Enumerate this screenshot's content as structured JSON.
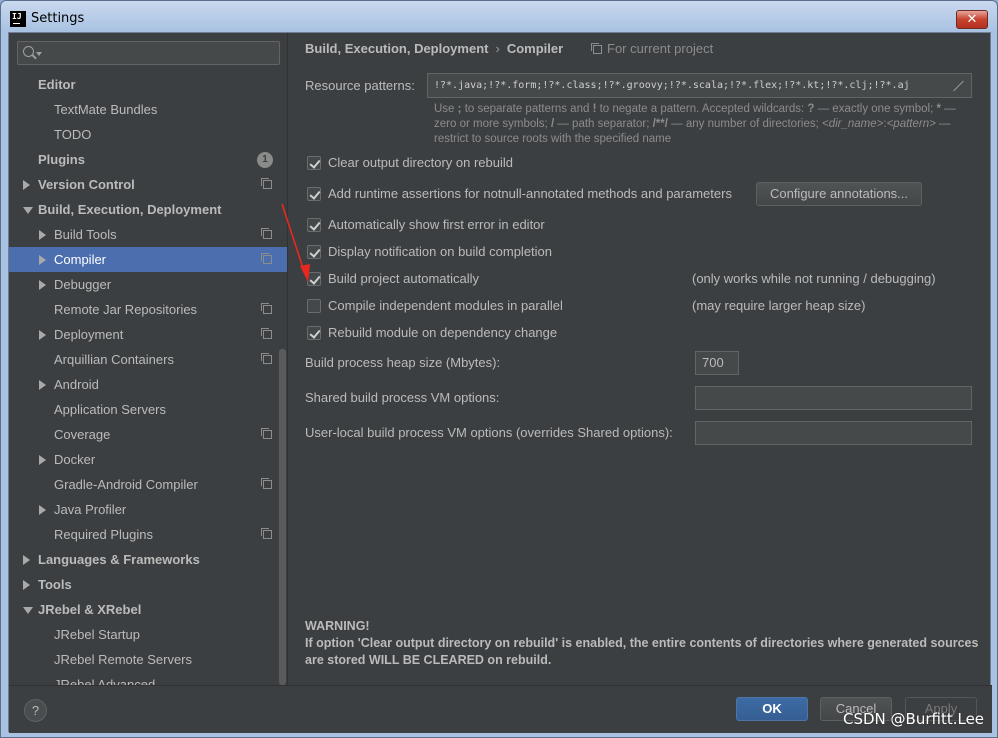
{
  "window": {
    "title": "Settings",
    "app_icon_text": "IJ",
    "close_label": "✕"
  },
  "sidebar": {
    "search_placeholder": "",
    "items": [
      {
        "label": "Editor",
        "level": 0,
        "bold": true,
        "arrow": "none",
        "project": false
      },
      {
        "label": "TextMate Bundles",
        "level": 1,
        "bold": false,
        "arrow": "none",
        "project": false
      },
      {
        "label": "TODO",
        "level": 1,
        "bold": false,
        "arrow": "none",
        "project": false
      },
      {
        "label": "Plugins",
        "level": 0,
        "bold": true,
        "arrow": "none",
        "project": false,
        "badge": "1"
      },
      {
        "label": "Version Control",
        "level": 0,
        "bold": true,
        "arrow": "right",
        "project": true
      },
      {
        "label": "Build, Execution, Deployment",
        "level": 0,
        "bold": true,
        "arrow": "down",
        "project": false
      },
      {
        "label": "Build Tools",
        "level": 1,
        "bold": false,
        "arrow": "right",
        "project": true
      },
      {
        "label": "Compiler",
        "level": 1,
        "bold": false,
        "arrow": "right",
        "project": true,
        "selected": true
      },
      {
        "label": "Debugger",
        "level": 1,
        "bold": false,
        "arrow": "right",
        "project": false
      },
      {
        "label": "Remote Jar Repositories",
        "level": 1,
        "bold": false,
        "arrow": "none",
        "project": true
      },
      {
        "label": "Deployment",
        "level": 1,
        "bold": false,
        "arrow": "right",
        "project": true
      },
      {
        "label": "Arquillian Containers",
        "level": 1,
        "bold": false,
        "arrow": "none",
        "project": true
      },
      {
        "label": "Android",
        "level": 1,
        "bold": false,
        "arrow": "right",
        "project": false
      },
      {
        "label": "Application Servers",
        "level": 1,
        "bold": false,
        "arrow": "none",
        "project": false
      },
      {
        "label": "Coverage",
        "level": 1,
        "bold": false,
        "arrow": "none",
        "project": true
      },
      {
        "label": "Docker",
        "level": 1,
        "bold": false,
        "arrow": "right",
        "project": false
      },
      {
        "label": "Gradle-Android Compiler",
        "level": 1,
        "bold": false,
        "arrow": "none",
        "project": true
      },
      {
        "label": "Java Profiler",
        "level": 1,
        "bold": false,
        "arrow": "right",
        "project": false
      },
      {
        "label": "Required Plugins",
        "level": 1,
        "bold": false,
        "arrow": "none",
        "project": true
      },
      {
        "label": "Languages & Frameworks",
        "level": 0,
        "bold": true,
        "arrow": "right",
        "project": false
      },
      {
        "label": "Tools",
        "level": 0,
        "bold": true,
        "arrow": "right",
        "project": false
      },
      {
        "label": "JRebel & XRebel",
        "level": 0,
        "bold": true,
        "arrow": "down",
        "project": false
      },
      {
        "label": "JRebel Startup",
        "level": 1,
        "bold": false,
        "arrow": "none",
        "project": false
      },
      {
        "label": "JRebel Remote Servers",
        "level": 1,
        "bold": false,
        "arrow": "none",
        "project": false
      },
      {
        "label": "JRebel Advanced",
        "level": 1,
        "bold": false,
        "arrow": "none",
        "project": false
      }
    ]
  },
  "main": {
    "breadcrumb": {
      "parent": "Build, Execution, Deployment",
      "separator": "›",
      "current": "Compiler"
    },
    "for_project": "For current project",
    "resource_patterns": {
      "label": "Resource patterns:",
      "value": "!?*.java;!?*.form;!?*.class;!?*.groovy;!?*.scala;!?*.flex;!?*.kt;!?*.clj;!?*.aj",
      "help": {
        "p1": "Use ",
        "semicolon": ";",
        "p2": " to separate patterns and ",
        "bang": "!",
        "p3": " to negate a pattern. Accepted wildcards: ",
        "q": "?",
        "p4": " — exactly one symbol; ",
        "star": "*",
        "p5": " — zero or more symbols; ",
        "slash": "/",
        "p6": " — path separator; ",
        "dstar": "/**/",
        "p7": " — any number of directories; ",
        "dirname": "<dir_name>",
        "colon": ":",
        "pattern": "<pattern>",
        "p8": " — restrict to source roots with the specified name"
      }
    },
    "options": [
      {
        "label": "Clear output directory on rebuild",
        "checked": true
      },
      {
        "label": "Add runtime assertions for notnull-annotated methods and parameters",
        "checked": true,
        "button": "Configure annotations..."
      },
      {
        "label": "Automatically show first error in editor",
        "checked": true
      },
      {
        "label": "Display notification on build completion",
        "checked": true
      },
      {
        "label": "Build project automatically",
        "checked": true,
        "note": "(only works while not running / debugging)"
      },
      {
        "label": "Compile independent modules in parallel",
        "checked": false,
        "note": "(may require larger heap size)"
      },
      {
        "label": "Rebuild module on dependency change",
        "checked": true
      }
    ],
    "heap_size": {
      "label": "Build process heap size (Mbytes):",
      "value": "700"
    },
    "shared_vm": {
      "label": "Shared build process VM options:",
      "value": ""
    },
    "user_vm": {
      "label": "User-local build process VM options (overrides Shared options):",
      "value": ""
    },
    "warning": {
      "title": "WARNING!",
      "body": "If option 'Clear output directory on rebuild' is enabled, the entire contents of directories where generated sources are stored WILL BE CLEARED on rebuild."
    }
  },
  "footer": {
    "help": "?",
    "ok": "OK",
    "cancel": "Cancel",
    "apply": "Apply"
  },
  "watermark": "CSDN @Burfitt.Lee",
  "colors": {
    "accent": "#4b6eaf",
    "background": "#3c3f41",
    "annotation_arrow": "#e8281e"
  }
}
